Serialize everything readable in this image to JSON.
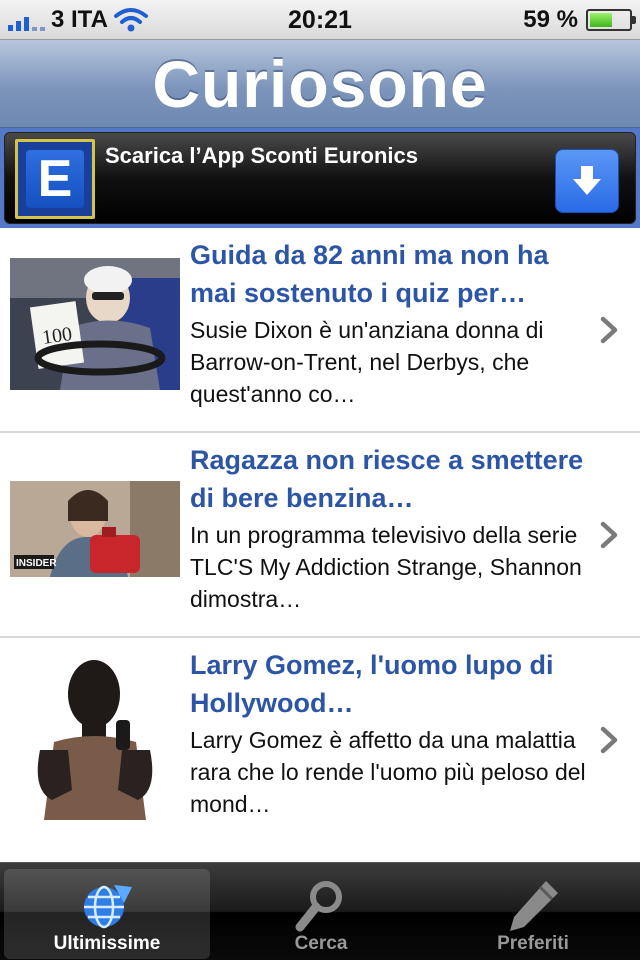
{
  "status_bar": {
    "carrier": "3 ITA",
    "time": "20:21",
    "battery_text": "59 %",
    "battery_level": 0.59
  },
  "header": {
    "title": "Curiosone"
  },
  "banner": {
    "logo_letter": "E",
    "text": "Scarica l’App Sconti Euronics"
  },
  "news": [
    {
      "title": "Guida da 82 anni ma non ha mai sostenuto i quiz per…",
      "summary": "Susie Dixon è un'anziana donna di Barrow-on-Trent, nel Derbys, che quest'anno co…",
      "thumb_text": "100"
    },
    {
      "title": "Ragazza non riesce a smettere di bere benzina…",
      "summary": "In un programma televisivo della serie TLC'S My Addiction Strange, Shannon dimostra…",
      "thumb_text": "INSIDER"
    },
    {
      "title": "Larry Gomez, l'uomo lupo di Hollywood…",
      "summary": "Larry Gomez è affetto da una malattia rara che lo rende l'uomo più peloso del mond…"
    }
  ],
  "tabs": [
    {
      "label": "Ultimissime",
      "icon": "globe-icon",
      "active": true
    },
    {
      "label": "Cerca",
      "icon": "magnifier-icon",
      "active": false
    },
    {
      "label": "Preferiti",
      "icon": "pencil-icon",
      "active": false
    }
  ]
}
